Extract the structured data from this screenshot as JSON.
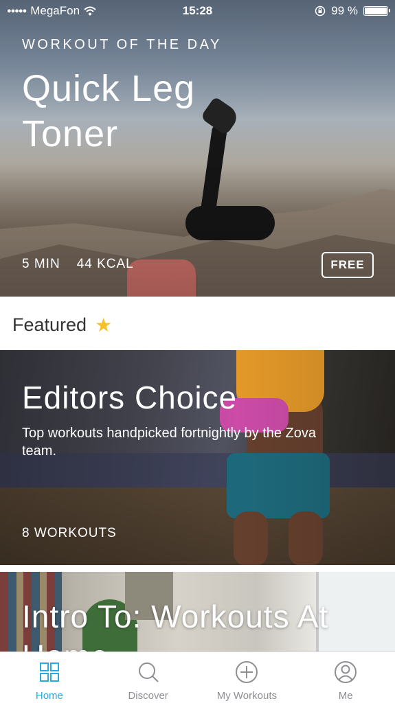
{
  "status_bar": {
    "carrier": "MegaFon",
    "time": "15:28",
    "battery_percent": "99 %",
    "battery_level": 0.99
  },
  "hero": {
    "eyebrow": "WORKOUT OF THE DAY",
    "title": "Quick Leg Toner",
    "duration": "5 MIN",
    "calories": "44 KCAL",
    "badge": "FREE"
  },
  "featured": {
    "label": "Featured",
    "icon": "star-icon"
  },
  "cards": [
    {
      "title": "Editors Choice",
      "description": "Top workouts handpicked fortnightly by the Zova team.",
      "count": "8 WORKOUTS"
    },
    {
      "title": "Intro To: Workouts At Home"
    }
  ],
  "tabbar": {
    "active_color": "#2aa8e0",
    "inactive_color": "#8e8e93",
    "tabs": [
      {
        "label": "Home",
        "icon": "grid-icon",
        "active": true
      },
      {
        "label": "Discover",
        "icon": "search-icon",
        "active": false
      },
      {
        "label": "My Workouts",
        "icon": "plus-circle-icon",
        "active": false
      },
      {
        "label": "Me",
        "icon": "profile-icon",
        "active": false
      }
    ]
  }
}
